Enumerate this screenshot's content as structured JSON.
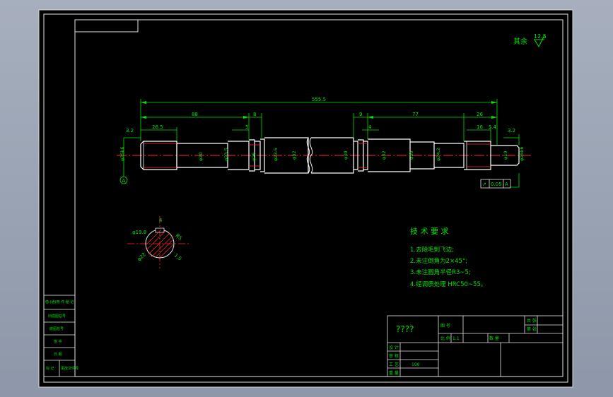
{
  "drawing": {
    "roughness": {
      "label": "其余",
      "value": "12.5"
    },
    "dimensions": {
      "overall": "555.5",
      "left_a": "88",
      "left_b": "8",
      "left_c": "5",
      "left_d": "26.5",
      "left_e": "3.2",
      "right_a": "9",
      "right_b": "77",
      "right_c": "26",
      "right_d": "4",
      "right_e": "16",
      "right_f": "5.4",
      "right_g": "3.2"
    },
    "diameters": {
      "d1": "φ25k6",
      "d2": "φ20",
      "d3": "φ23.5",
      "d4": "φ26",
      "d5": "φ23.5",
      "d6": "φ32",
      "d7": "φ30",
      "d8": "φ32",
      "d9": "φ30",
      "d10": "φ24.2",
      "d11": "φ19",
      "d12": "φ25k6"
    },
    "datum": "A",
    "tolerance_frame": {
      "symbol": "↗",
      "value": "0.05",
      "datum": "A"
    },
    "section": {
      "width": "4",
      "dia_a": "φ19.8",
      "dia_b": "φ22",
      "r1": "R5",
      "r2": "1.5"
    },
    "tech_req": {
      "title": "技 术 要 求",
      "items": [
        "1.去除毛刺飞边;",
        "2.未注倒角为2×45°;",
        "3.未注圆角半径R3~5;",
        "4.经调质处理 HRC50~55。"
      ]
    },
    "title_block": {
      "part_name": "????",
      "ratio": "1:1",
      "count_label": "数 量",
      "scale_label": "比 例",
      "drawn": "设 计",
      "checked": "审 核",
      "process": "工 艺",
      "qty": "100",
      "sheet_a": "共  张",
      "sheet_b": "第  张",
      "drawing_no": "图 号",
      "weight": "重 量"
    },
    "left_block": [
      "借 (通)用 件 登 记",
      "旧底图总号",
      "底图总号",
      "签 字",
      "日 期",
      "标 记",
      "更改文件号"
    ]
  }
}
